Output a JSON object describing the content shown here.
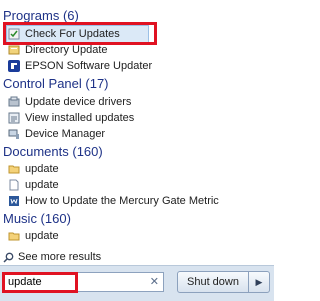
{
  "groups": [
    {
      "header": "Programs (6)",
      "items": [
        {
          "label": "Check For Updates",
          "icon": "update-check-icon"
        },
        {
          "label": "Directory Update",
          "icon": "directory-icon"
        },
        {
          "label": "EPSON Software Updater",
          "icon": "epson-icon"
        }
      ]
    },
    {
      "header": "Control Panel (17)",
      "items": [
        {
          "label": "Update device drivers",
          "icon": "device-drivers-icon"
        },
        {
          "label": "View installed updates",
          "icon": "installed-updates-icon"
        },
        {
          "label": "Device Manager",
          "icon": "device-manager-icon"
        }
      ]
    },
    {
      "header": "Documents (160)",
      "items": [
        {
          "label": "update",
          "icon": "folder-icon"
        },
        {
          "label": "update",
          "icon": "document-icon"
        },
        {
          "label": "How to Update the Mercury Gate Metric",
          "icon": "word-document-icon"
        }
      ]
    },
    {
      "header": "Music (160)",
      "items": [
        {
          "label": "update",
          "icon": "folder-icon"
        }
      ]
    }
  ],
  "see_more": "See more results",
  "search": {
    "value": "update"
  },
  "shutdown_label": "Shut down",
  "colors": {
    "header": "#1e3287",
    "highlight": "#e01222",
    "bottom_bar": "#d8e3ef"
  }
}
